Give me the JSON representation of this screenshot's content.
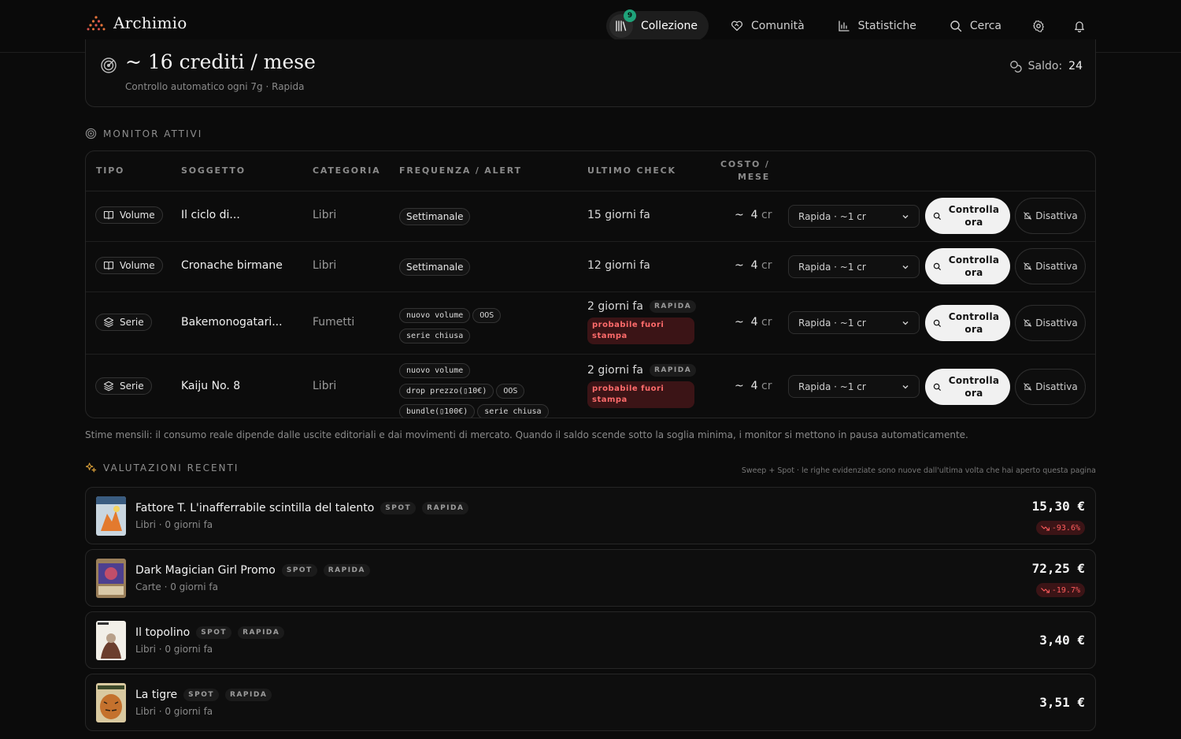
{
  "app": {
    "name": "Archimio"
  },
  "nav": {
    "items": [
      {
        "label": "Collezione",
        "badge": "9",
        "icon": "library-icon",
        "active": true
      },
      {
        "label": "Comunità",
        "icon": "heart-handshake-icon"
      },
      {
        "label": "Statistiche",
        "icon": "bar-chart-icon"
      },
      {
        "label": "Cerca",
        "icon": "search-icon"
      }
    ],
    "settings_icon": "gear-icon",
    "notifications_icon": "bell-icon"
  },
  "summary": {
    "title": "~ 16 crediti / mese",
    "subtitle": "Controllo automatico ogni 7g · Rapida",
    "saldo_label": "Saldo:",
    "saldo_value": "24"
  },
  "monitors": {
    "section_label": "MONITOR ATTIVI",
    "columns": {
      "tipo": "TIPO",
      "soggetto": "SOGGETTO",
      "categoria": "CATEGORIA",
      "frequenza": "FREQUENZA / ALERT",
      "ultimo": "ULTIMO CHECK",
      "costo_1": "COSTO /",
      "costo_2": "MESE"
    },
    "rows": [
      {
        "type": "Volume",
        "subject": "Il ciclo di...",
        "category": "Libri",
        "frequency": "Settimanale",
        "alerts": [],
        "last_check": "15 giorni fa",
        "speed": "",
        "status": "",
        "cost_prefix": "~",
        "cost_value": "4",
        "cost_unit": "cr",
        "plan": "Rapida · ~1 cr",
        "check_label_1": "Controlla",
        "check_label_2": "ora",
        "disable_label": "Disattiva"
      },
      {
        "type": "Volume",
        "subject": "Cronache birmane",
        "category": "Libri",
        "frequency": "Settimanale",
        "alerts": [],
        "last_check": "12 giorni fa",
        "speed": "",
        "status": "",
        "cost_prefix": "~",
        "cost_value": "4",
        "cost_unit": "cr",
        "plan": "Rapida · ~1 cr",
        "check_label_1": "Controlla",
        "check_label_2": "ora",
        "disable_label": "Disattiva"
      },
      {
        "type": "Serie",
        "subject": "Bakemonogatari...",
        "category": "Fumetti",
        "frequency": "",
        "alerts": [
          "nuovo volume",
          "OOS",
          "serie chiusa"
        ],
        "last_check": "2 giorni fa",
        "speed": "RAPIDA",
        "status_1": "probabile fuori",
        "status_2": "stampa",
        "cost_prefix": "~",
        "cost_value": "4",
        "cost_unit": "cr",
        "plan": "Rapida · ~1 cr",
        "check_label_1": "Controlla",
        "check_label_2": "ora",
        "disable_label": "Disattiva"
      },
      {
        "type": "Serie",
        "subject": "Kaiju No. 8",
        "category": "Libri",
        "frequency": "",
        "alerts": [
          "nuovo volume",
          "drop prezzo(▯10€)",
          "OOS",
          "bundle(▯100€)",
          "serie chiusa"
        ],
        "last_check": "2 giorni fa",
        "speed": "RAPIDA",
        "status_1": "probabile fuori",
        "status_2": "stampa",
        "cost_prefix": "~",
        "cost_value": "4",
        "cost_unit": "cr",
        "plan": "Rapida · ~1 cr",
        "check_label_1": "Controlla",
        "check_label_2": "ora",
        "disable_label": "Disattiva"
      }
    ],
    "note": "Stime mensili: il consumo reale dipende dalle uscite editoriali e dai movimenti di mercato. Quando il saldo scende sotto la soglia minima, i monitor si mettono in pausa automaticamente."
  },
  "evaluations": {
    "section_label": "VALUTAZIONI RECENTI",
    "hint": "Sweep + Spot · le righe evidenziate sono nuove dall'ultima volta che hai aperto questa pagina",
    "items": [
      {
        "title": "Fattore T. L'inafferrabile scintilla del talento",
        "tags": [
          "SPOT",
          "RAPIDA"
        ],
        "meta": "Libri · 0 giorni fa",
        "price": "15,30 €",
        "delta": "-93.6%",
        "colors": [
          "#c9d6e0",
          "#e37a2e",
          "#3a5c80"
        ]
      },
      {
        "title": "Dark Magician Girl Promo",
        "tags": [
          "SPOT",
          "RAPIDA"
        ],
        "meta": "Carte · 0 giorni fa",
        "price": "72,25 €",
        "delta": "-19.7%",
        "colors": [
          "#9a7f5a",
          "#4d3f8f",
          "#c24e6a"
        ]
      },
      {
        "title": "Il topolino",
        "tags": [
          "SPOT",
          "RAPIDA"
        ],
        "meta": "Libri · 0 giorni fa",
        "price": "3,40 €",
        "delta": "",
        "colors": [
          "#f2efe8",
          "#6b3e2e",
          "#b8a08a"
        ]
      },
      {
        "title": "La tigre",
        "tags": [
          "SPOT",
          "RAPIDA"
        ],
        "meta": "Libri · 0 giorni fa",
        "price": "3,51 €",
        "delta": "",
        "colors": [
          "#d9c9a0",
          "#c4712d",
          "#3d4a2a"
        ]
      }
    ]
  }
}
